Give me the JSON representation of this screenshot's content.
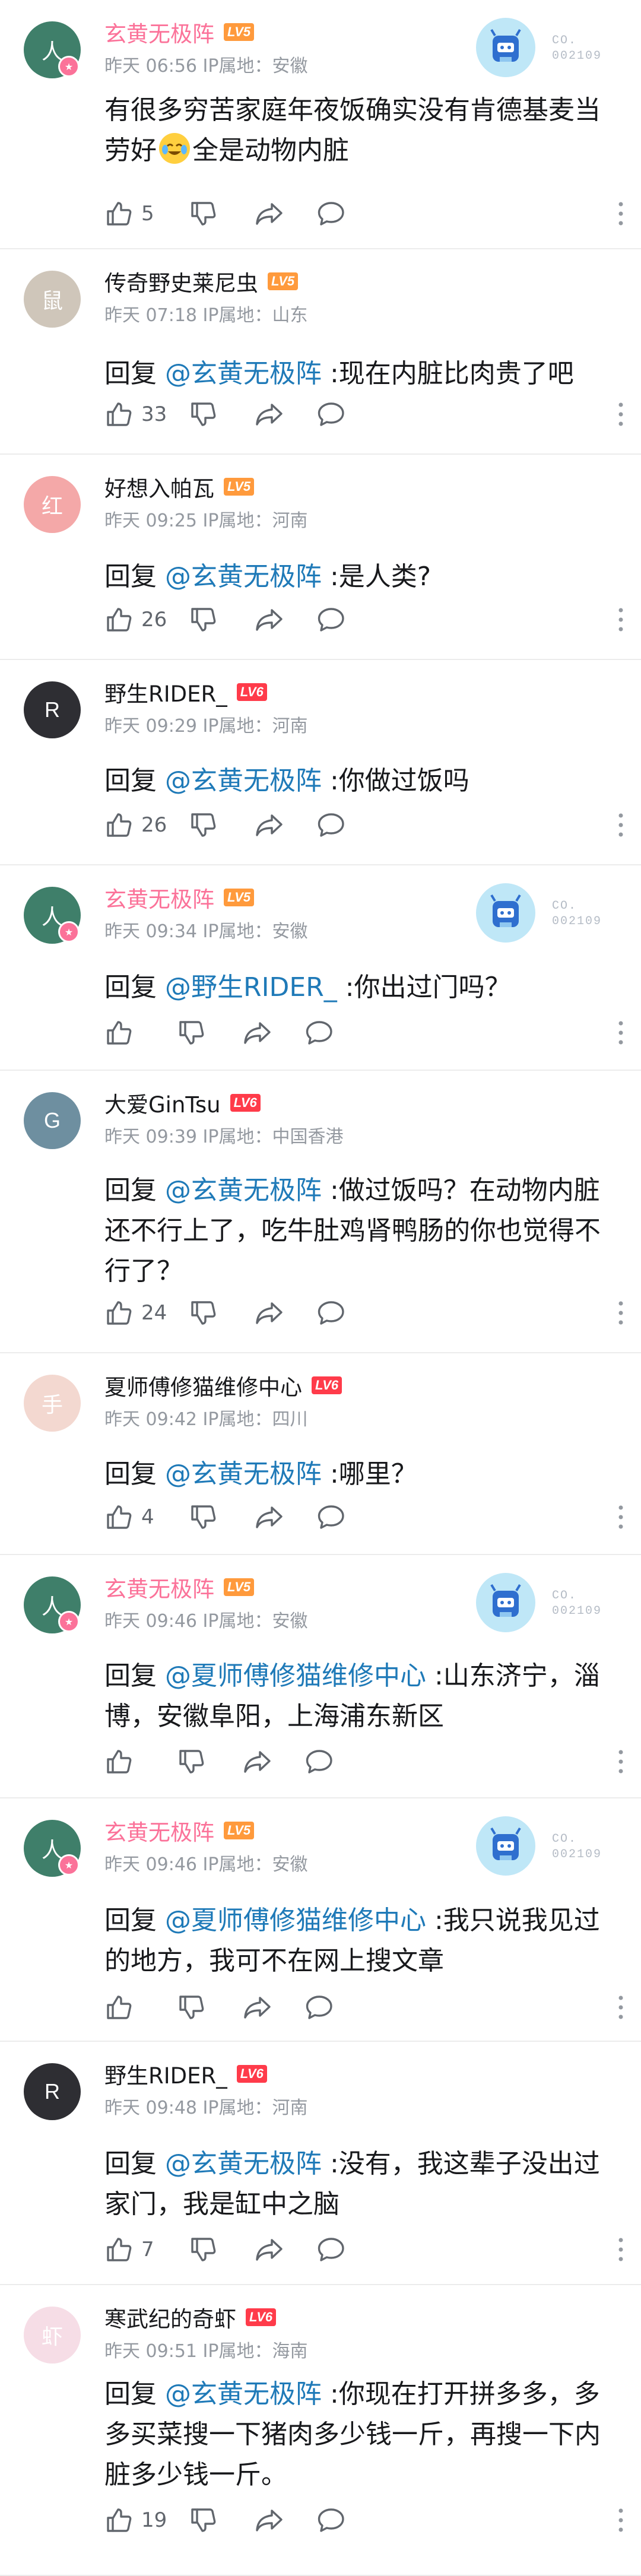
{
  "comments": [
    {
      "user": "玄黄无极阵",
      "level": "LV5",
      "time": "昨天 06:56",
      "ip": "IP属地：安徽",
      "vip": true,
      "fan": true,
      "fan_text_1": "CO.",
      "fan_text_2": "002109",
      "text_before": "有很多穷苦家庭年夜饭确实没有肯德基麦当劳好",
      "text_after": "全是动物内脏",
      "likes": "5"
    },
    {
      "user": "传奇野史莱尼虫",
      "level": "LV5",
      "time": "昨天 07:18",
      "ip": "IP属地：山东",
      "reply_prefix": "回复 ",
      "at": "@玄黄无极阵",
      "text": " :现在内脏比肉贵了吧",
      "likes": "33"
    },
    {
      "user": "好想入帕瓦",
      "level": "LV5",
      "time": "昨天 09:25",
      "ip": "IP属地：河南",
      "reply_prefix": "回复 ",
      "at": "@玄黄无极阵",
      "text": " :是人类?",
      "likes": "26"
    },
    {
      "user": "野生RIDER_",
      "level": "LV6",
      "time": "昨天 09:29",
      "ip": "IP属地：河南",
      "reply_prefix": "回复 ",
      "at": "@玄黄无极阵",
      "text": " :你做过饭吗",
      "likes": "26"
    },
    {
      "user": "玄黄无极阵",
      "level": "LV5",
      "time": "昨天 09:34",
      "ip": "IP属地：安徽",
      "vip": true,
      "fan": true,
      "fan_text_1": "CO.",
      "fan_text_2": "002109",
      "reply_prefix": "回复 ",
      "at": "@野生RIDER_",
      "text": " :你出过门吗？",
      "likes": ""
    },
    {
      "user": "大爱GinTsu",
      "level": "LV6",
      "time": "昨天 09:39",
      "ip": "IP属地：中国香港",
      "reply_prefix": "回复 ",
      "at": "@玄黄无极阵",
      "text": " :做过饭吗？在动物内脏还不行上了，吃牛肚鸡肾鸭肠的你也觉得不行了？",
      "likes": "24"
    },
    {
      "user": "夏师傅修猫维修中心",
      "level": "LV6",
      "time": "昨天 09:42",
      "ip": "IP属地：四川",
      "reply_prefix": "回复 ",
      "at": "@玄黄无极阵",
      "text": " :哪里？",
      "likes": "4"
    },
    {
      "user": "玄黄无极阵",
      "level": "LV5",
      "time": "昨天 09:46",
      "ip": "IP属地：安徽",
      "vip": true,
      "fan": true,
      "fan_text_1": "CO.",
      "fan_text_2": "002109",
      "reply_prefix": "回复 ",
      "at": "@夏师傅修猫维修中心",
      "text": " :山东济宁，淄博，安徽阜阳，上海浦东新区",
      "likes": ""
    },
    {
      "user": "玄黄无极阵",
      "level": "LV5",
      "time": "昨天 09:46",
      "ip": "IP属地：安徽",
      "vip": true,
      "fan": true,
      "fan_text_1": "CO.",
      "fan_text_2": "002109",
      "reply_prefix": "回复 ",
      "at": "@夏师傅修猫维修中心",
      "text": " :我只说我见过的地方，我可不在网上搜文章",
      "likes": ""
    },
    {
      "user": "野生RIDER_",
      "level": "LV6",
      "time": "昨天 09:48",
      "ip": "IP属地：河南",
      "reply_prefix": "回复 ",
      "at": "@玄黄无极阵",
      "text": " :没有，我这辈子没出过家门，我是缸中之脑",
      "likes": "7"
    },
    {
      "user": "寒武纪的奇虾",
      "level": "LV6",
      "time": "昨天 09:51",
      "ip": "IP属地：海南",
      "reply_prefix": "回复 ",
      "at": "@玄黄无极阵",
      "text": " :你现在打开拼多多，多多买菜搜一下猪肉多少钱一斤，再搜一下内脏多少钱一斤。",
      "likes": "19"
    }
  ],
  "colors": {
    "vip_name": "#fb7299",
    "at_link": "#1f7ab8",
    "meta": "#9499a0",
    "lv5": "#ff9a3c",
    "lv6": "#ff3b4a"
  },
  "icons": {
    "like": "thumb-up-icon",
    "dislike": "thumb-down-icon",
    "share": "share-icon",
    "reply": "comment-bubble-icon",
    "more": "more-vertical-icon"
  }
}
